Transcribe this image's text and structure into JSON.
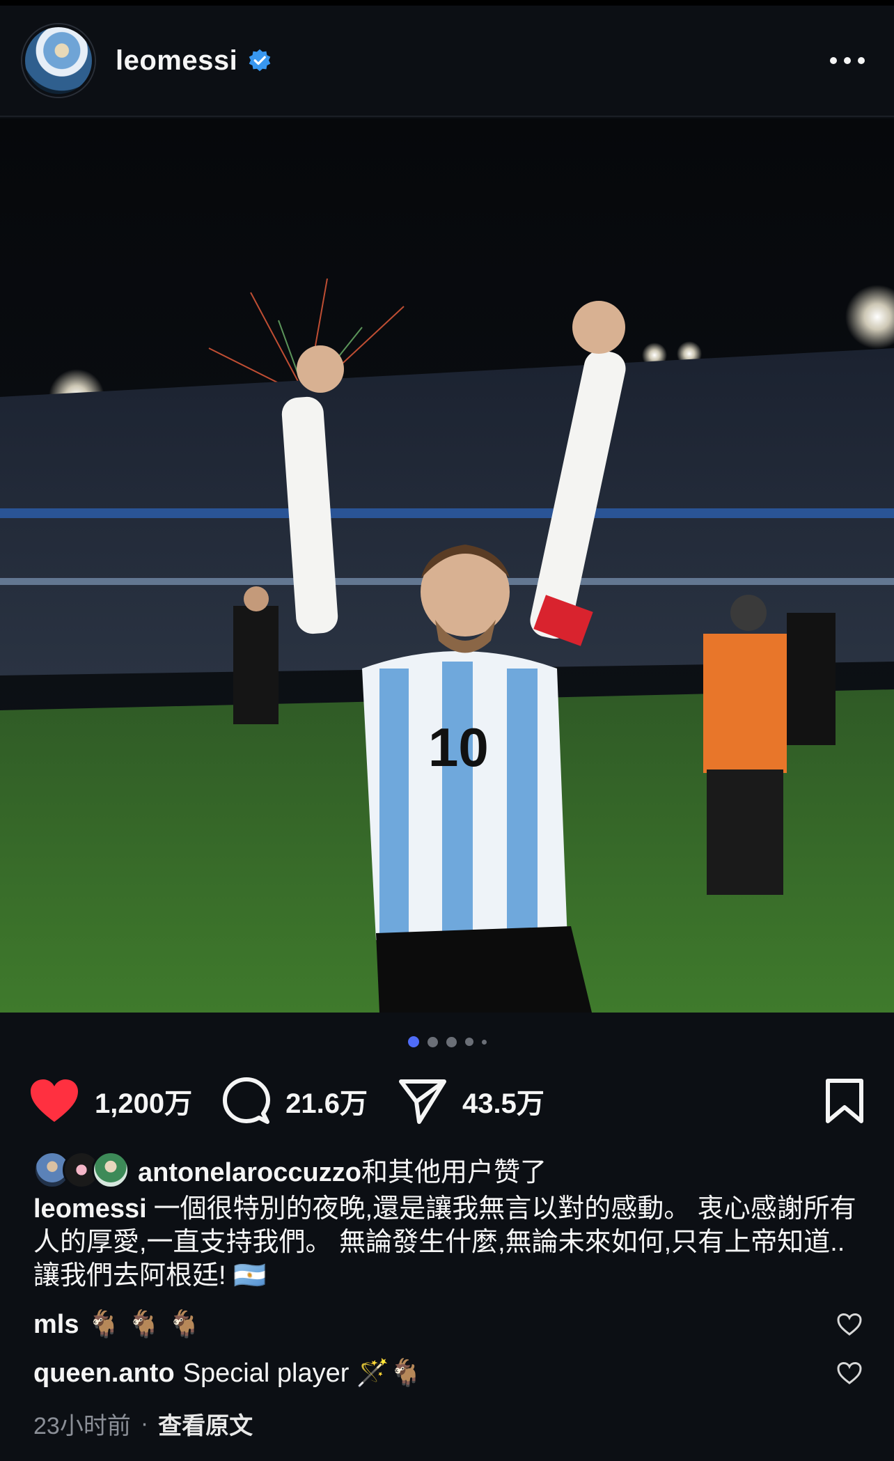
{
  "header": {
    "username": "leomessi",
    "avatar_icon": "avatar",
    "verified_icon": "verified-badge-icon",
    "more_icon": "more-options-icon"
  },
  "photo": {
    "description_icon": "post-image"
  },
  "carousel": {
    "total": 5,
    "active": 0,
    "accent": "#4f6cf7"
  },
  "actions": {
    "like_count": "1,200万",
    "comment_count": "21.6万",
    "share_count": "43.5万",
    "like_color": "#ff3040"
  },
  "likes": {
    "user": "antonelaroccuzzo",
    "suffix": "和其他用户赞了"
  },
  "caption": {
    "username": "leomessi",
    "text": "一個很特別的夜晚,還是讓我無言以對的感動。 衷心感謝所有人的厚愛,一直支持我們。 無論發生什麼,無論未來如何,只有上帝知道.. 讓我們去阿根廷! 🇦🇷"
  },
  "comments": [
    {
      "username": "mls",
      "text": "🐐 🐐 🐐"
    },
    {
      "username": "queen.anto",
      "text": "Special player 🪄🐐"
    }
  ],
  "meta": {
    "time": "23小时前",
    "separator": "·",
    "see_original": "查看原文"
  }
}
